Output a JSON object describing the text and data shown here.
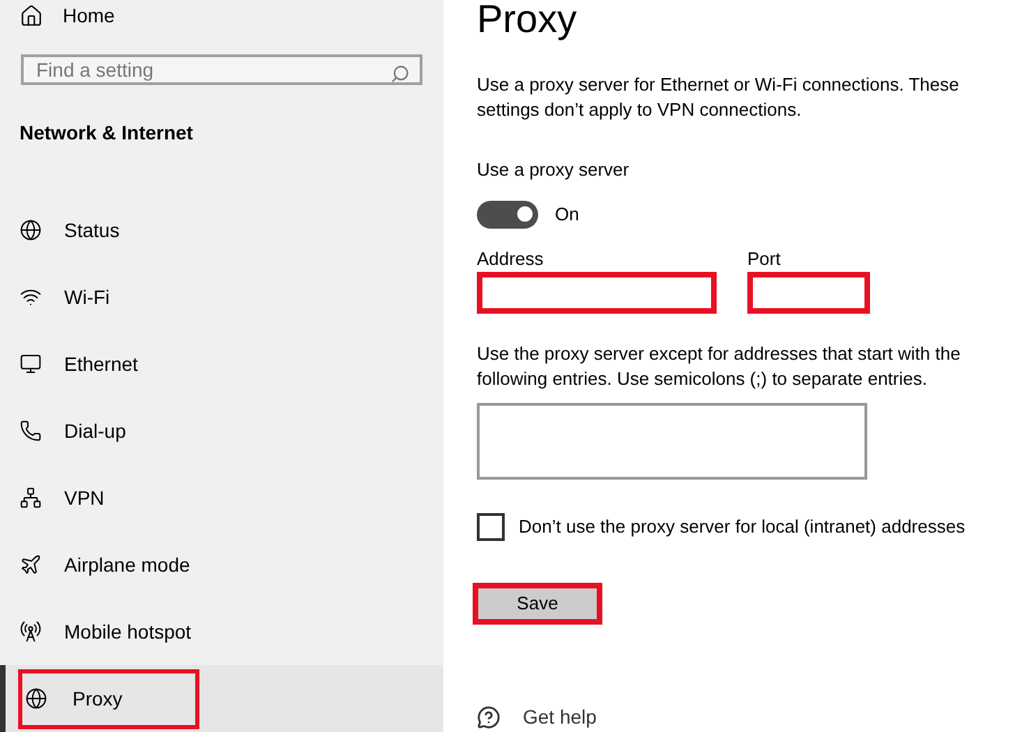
{
  "sidebar": {
    "home": "Home",
    "search": {
      "placeholder": "Find a setting"
    },
    "section": "Network & Internet",
    "items": [
      {
        "label": "Status",
        "selected": false,
        "highlighted": false
      },
      {
        "label": "Wi-Fi",
        "selected": false,
        "highlighted": false
      },
      {
        "label": "Ethernet",
        "selected": false,
        "highlighted": false
      },
      {
        "label": "Dial-up",
        "selected": false,
        "highlighted": false
      },
      {
        "label": "VPN",
        "selected": false,
        "highlighted": false
      },
      {
        "label": "Airplane mode",
        "selected": false,
        "highlighted": false
      },
      {
        "label": "Mobile hotspot",
        "selected": false,
        "highlighted": false
      },
      {
        "label": "Proxy",
        "selected": true,
        "highlighted": true
      }
    ]
  },
  "content": {
    "title": "Proxy",
    "description": "Use a proxy server for Ethernet or Wi-Fi connections. These settings don’t apply to VPN connections.",
    "proxy_toggle": {
      "label": "Use a proxy server",
      "on": true,
      "state_text": "On"
    },
    "address": {
      "label": "Address",
      "highlighted": true
    },
    "port": {
      "label": "Port",
      "highlighted": true
    },
    "exceptions": {
      "label": "Use the proxy server except for addresses that start with the following entries. Use semicolons (;) to separate entries."
    },
    "local_checkbox": {
      "label": "Don’t use the proxy server for local (intranet) addresses",
      "checked": false
    },
    "save": {
      "label": "Save",
      "highlighted": true
    },
    "help": "Get help"
  }
}
